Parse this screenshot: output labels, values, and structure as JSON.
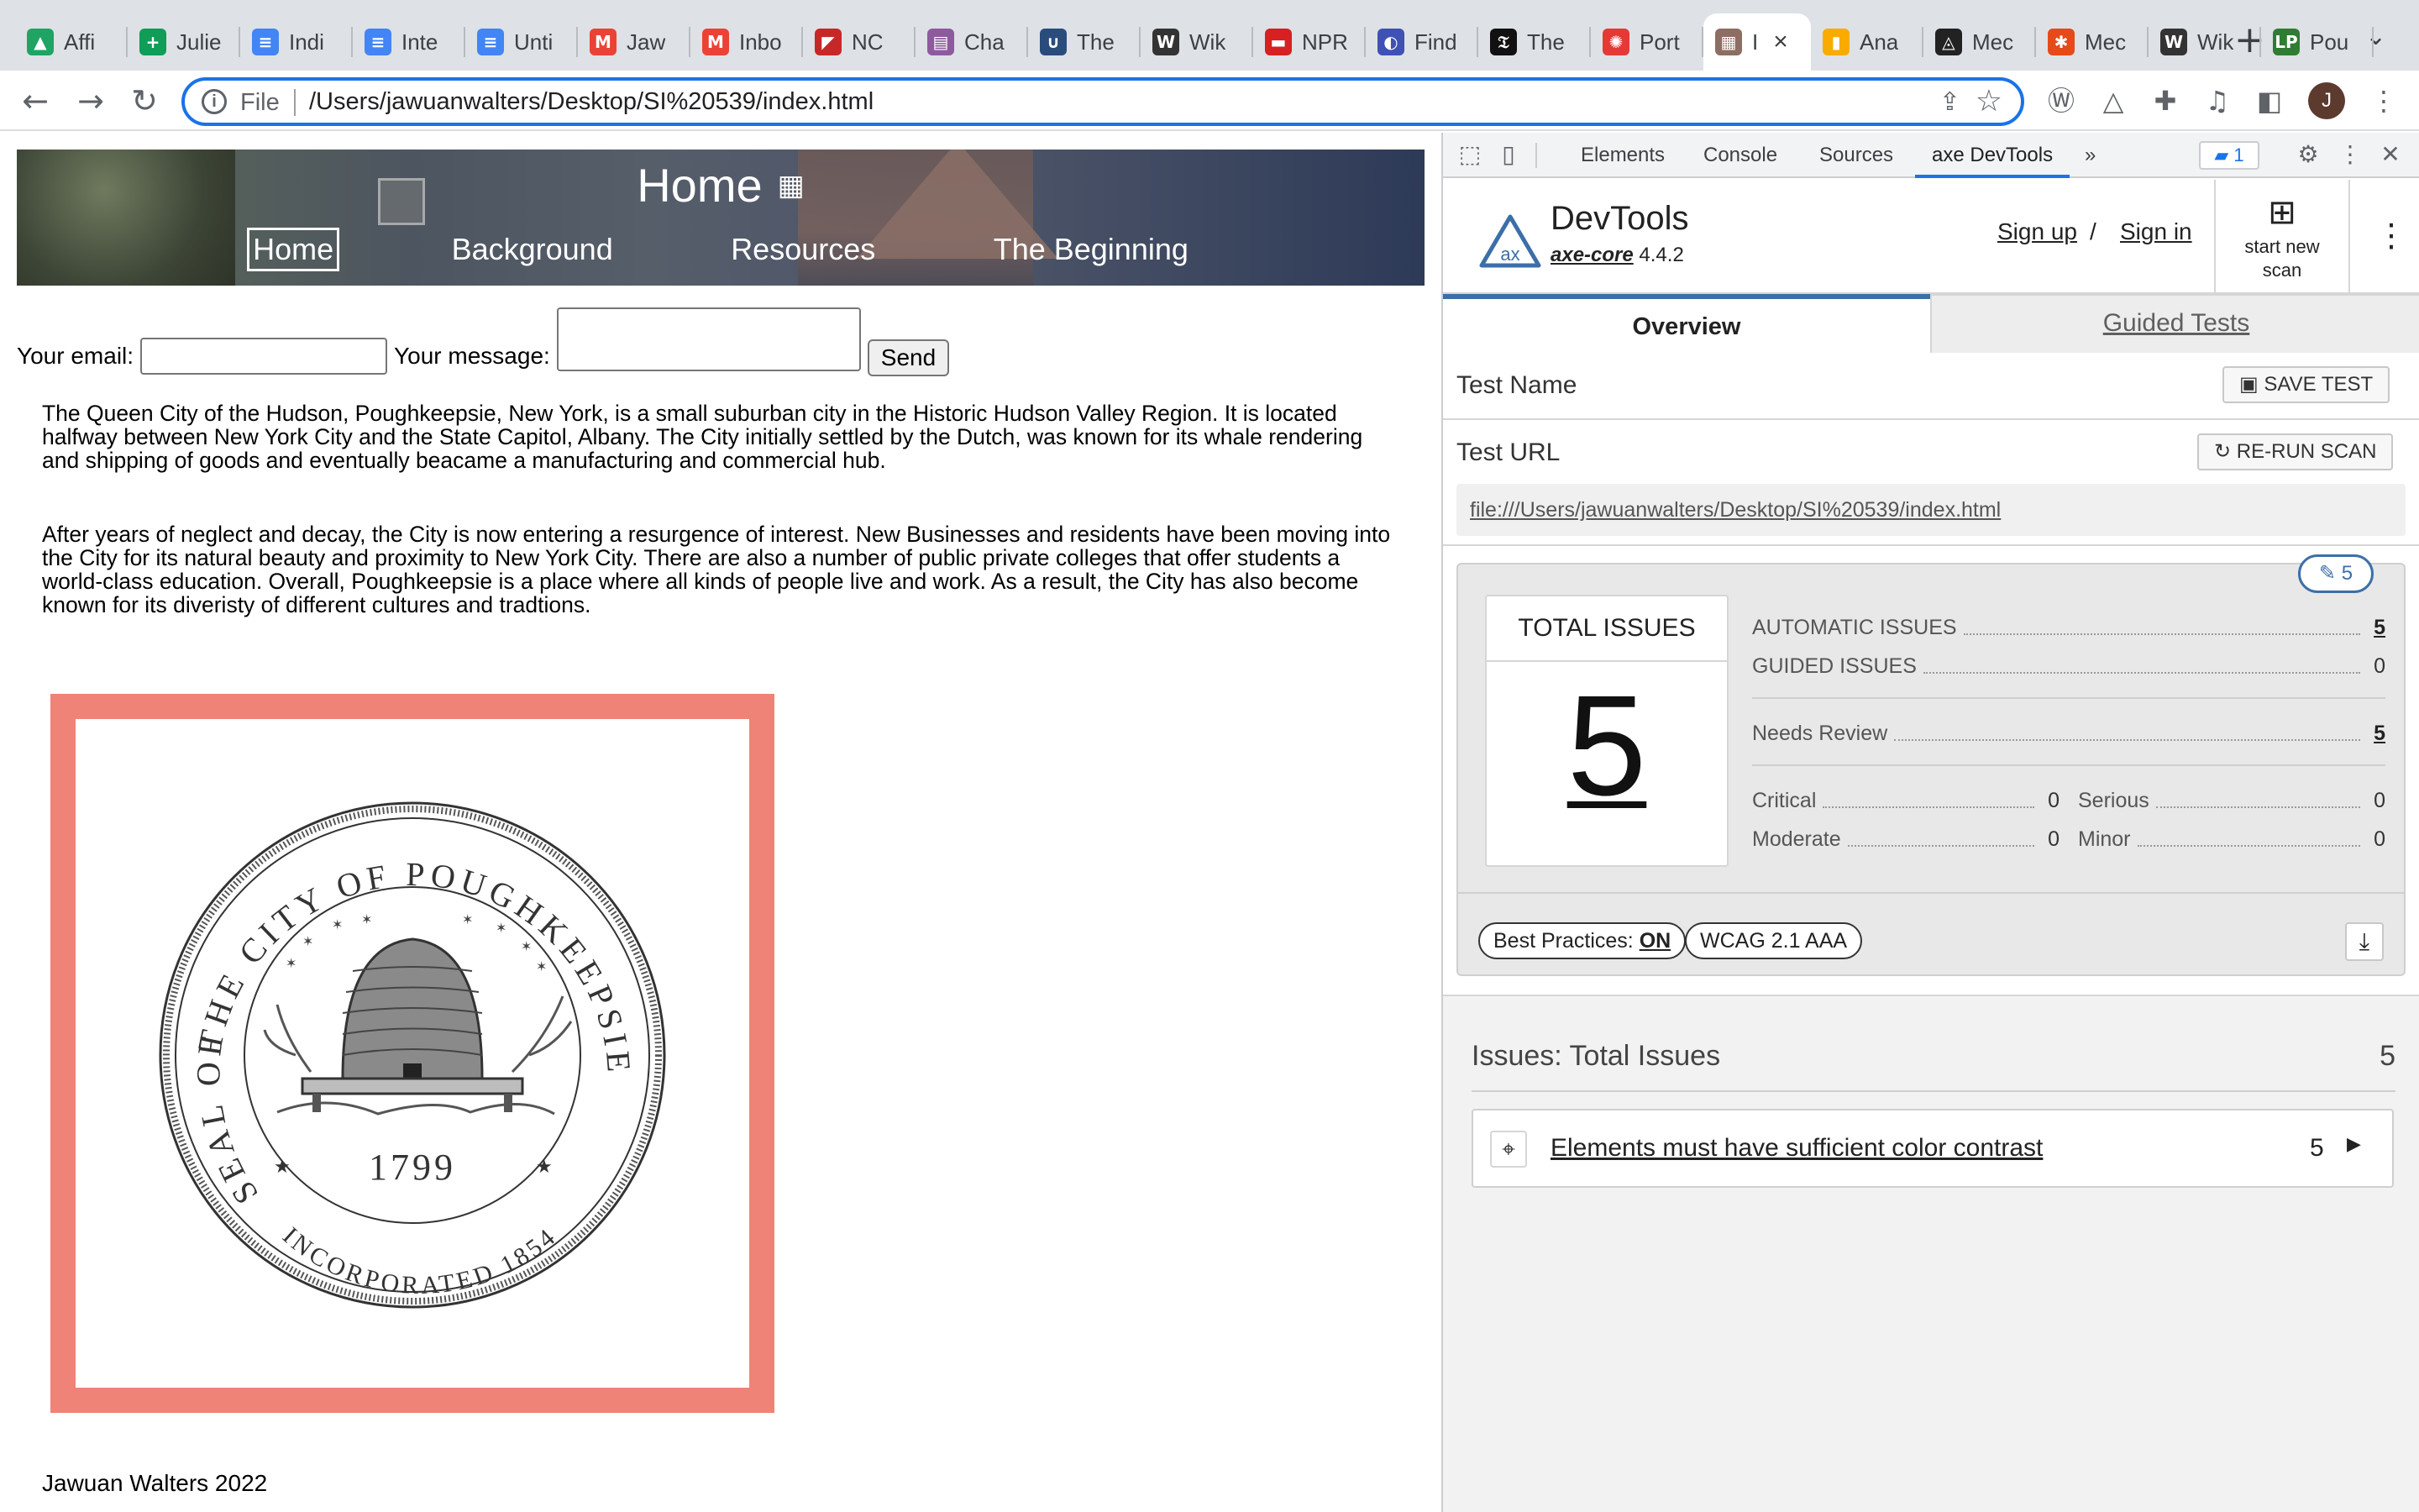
{
  "browser": {
    "tabs": [
      {
        "label": "Affi",
        "icon": "google-drive-icon",
        "color": "#1fa463"
      },
      {
        "label": "Julie",
        "icon": "google-sheets-icon",
        "color": "#0f9d58"
      },
      {
        "label": "Indi",
        "icon": "google-docs-icon",
        "color": "#4285f4"
      },
      {
        "label": "Inte",
        "icon": "google-docs-icon",
        "color": "#4285f4"
      },
      {
        "label": "Unti",
        "icon": "google-docs-icon",
        "color": "#4285f4"
      },
      {
        "label": "Jaw",
        "icon": "gmail-icon",
        "color": "#ea4335"
      },
      {
        "label": "Inbo",
        "icon": "gmail-icon",
        "color": "#ea4335"
      },
      {
        "label": "NC",
        "icon": "nc-icon",
        "color": "#c62828"
      },
      {
        "label": "Cha",
        "icon": "chart-icon",
        "color": "#8e5a9e"
      },
      {
        "label": "The",
        "icon": "hook-icon",
        "color": "#2a4c7d"
      },
      {
        "label": "Wik",
        "icon": "wikipedia-icon",
        "color": "#333333"
      },
      {
        "label": "NPR",
        "icon": "npr-icon",
        "color": "#d62021"
      },
      {
        "label": "Find",
        "icon": "find-icon",
        "color": "#3f51b5"
      },
      {
        "label": "The",
        "icon": "nytimes-icon",
        "color": "#111111"
      },
      {
        "label": "Port",
        "icon": "portal-icon",
        "color": "#e53935"
      },
      {
        "label": "I",
        "icon": "page-thumbnail-icon",
        "color": "#8d6e63",
        "active": true
      },
      {
        "label": "Ana",
        "icon": "analytics-icon",
        "color": "#f9ab00"
      },
      {
        "label": "Mec",
        "icon": "medium-icon",
        "color": "#222222"
      },
      {
        "label": "Mec",
        "icon": "asterisk-icon",
        "color": "#e64a19"
      },
      {
        "label": "Wik",
        "icon": "wikipedia-icon",
        "color": "#333333"
      },
      {
        "label": "Pou",
        "icon": "lp-icon",
        "color": "#2e7d32"
      }
    ],
    "tab_glyphs": [
      "▲",
      "+",
      "≡",
      "≡",
      "≡",
      "M",
      "M",
      "◤",
      "▤",
      "∪",
      "W",
      "▬",
      "◐",
      "𝔗",
      "✺",
      "▦",
      "▮",
      "◬",
      "✱",
      "W",
      "LP"
    ],
    "new_tab": "+",
    "address": {
      "scheme": "File",
      "url": "/Users/jawuanwalters/Desktop/SI%20539/index.html"
    },
    "profile_initial": "J"
  },
  "site": {
    "banner_title": "Home",
    "banner_icon": "calendar-grid-icon",
    "nav": [
      "Home",
      "Background",
      "Resources",
      "The Beginning"
    ],
    "form": {
      "email_label": "Your email:",
      "email_value": "",
      "message_label": "Your message:",
      "message_value": "",
      "send_label": "Send"
    },
    "paragraphs": [
      "The Queen City of the Hudson, Poughkeepsie, New York, is a small suburban city in the Historic Hudson Valley Region. It is located halfway between New York City and the State Capitol, Albany. The City initially settled by the Dutch, was known for its whale rendering and shipping of goods and eventually beacame a manufacturing and commercial hub.",
      "After years of neglect and decay, the City is now entering a resurgence of interest. New Businesses and residents have been moving into the City for its natural beauty and proximity to New York City. There are also a number of public private colleges that offer students a world-class education. Overall, Poughkeepsie is a place where all kinds of people live and work. As a result, the City has also become known for its diveristy of different cultures and tradtions."
    ],
    "seal": {
      "top_text": "THE CITY OF POUGHKEEPSIE",
      "left_text": "SEAL OF",
      "year": "1799",
      "bottom_text": "INCORPORATED 1854"
    },
    "footer": "Jawuan Walters 2022"
  },
  "devtools": {
    "tabs": [
      "Elements",
      "Console",
      "Sources",
      "axe DevTools"
    ],
    "active_tab": "axe DevTools",
    "more": "»",
    "issues_badge": "1",
    "axe": {
      "title": "DevTools",
      "core_name": "axe-core",
      "core_version": "4.4.2",
      "sign_up": "Sign up",
      "slash": "/",
      "sign_in": "Sign in",
      "new_scan_label": "start new scan",
      "tabs": {
        "overview": "Overview",
        "guided": "Guided Tests"
      },
      "test_name_label": "Test Name",
      "save_test": "SAVE TEST",
      "test_url_label": "Test URL",
      "rerun_scan": "RE-RUN SCAN",
      "test_url": "file:///Users/jawuanwalters/Desktop/SI%20539/index.html",
      "pill_count": "5",
      "total_issues_label": "TOTAL ISSUES",
      "total_issues": "5",
      "automatic_label": "AUTOMATIC ISSUES",
      "automatic": "5",
      "guided_label": "GUIDED ISSUES",
      "guided": "0",
      "needs_review_label": "Needs Review",
      "needs_review": "5",
      "critical_label": "Critical",
      "critical": "0",
      "serious_label": "Serious",
      "serious": "0",
      "moderate_label": "Moderate",
      "moderate": "0",
      "minor_label": "Minor",
      "minor": "0",
      "best_practices_label": "Best Practices:",
      "best_practices_value": "ON",
      "standard": "WCAG 2.1 AAA",
      "issues_heading": "Issues: Total Issues",
      "issues_total": "5",
      "issues": [
        {
          "title": "Elements must have sufficient color contrast",
          "count": "5"
        }
      ]
    }
  },
  "colors": {
    "accent_blue": "#1a73e8",
    "seal_frame": "#f08378",
    "axe_blue": "#3c6fa8"
  }
}
